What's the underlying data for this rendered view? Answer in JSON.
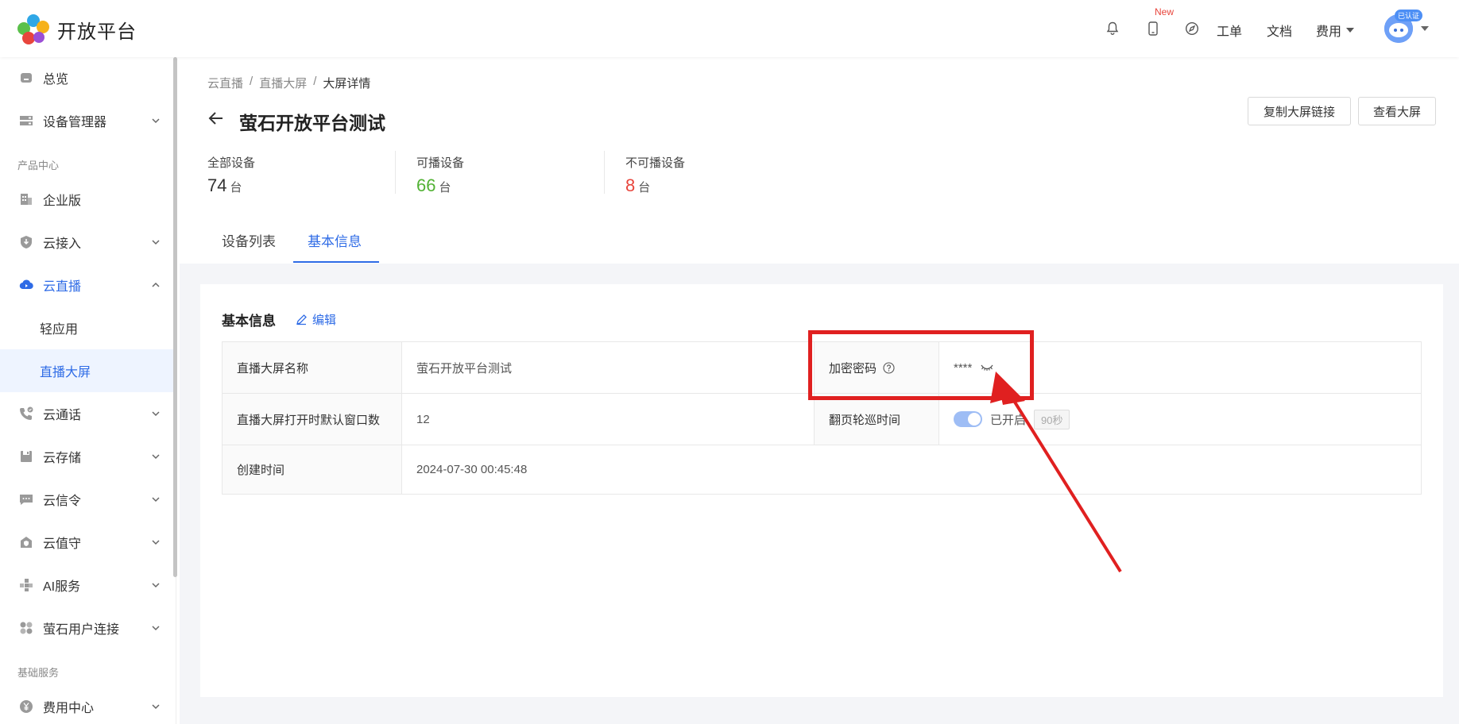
{
  "header": {
    "logo_text": "开放平台",
    "new_badge": "New",
    "links": [
      "工单",
      "文档"
    ],
    "fee_label": "费用",
    "verified_label": "已认证"
  },
  "sidebar": {
    "items": [
      {
        "label": "总览",
        "icon": "home-icon"
      },
      {
        "label": "设备管理器",
        "icon": "device-manager-icon"
      },
      {
        "label": "企业版",
        "icon": "building-icon"
      },
      {
        "label": "云接入",
        "icon": "cloud-access-icon"
      },
      {
        "label": "云直播",
        "icon": "cloud-live-icon"
      },
      {
        "label": "云通话",
        "icon": "phone-icon"
      },
      {
        "label": "云存储",
        "icon": "storage-icon"
      },
      {
        "label": "云信令",
        "icon": "message-icon"
      },
      {
        "label": "云值守",
        "icon": "guard-icon"
      },
      {
        "label": "AI服务",
        "icon": "ai-icon"
      },
      {
        "label": "萤石用户连接",
        "icon": "user-connect-icon"
      },
      {
        "label": "费用中心",
        "icon": "yen-icon"
      }
    ],
    "subitems": [
      "轻应用",
      "直播大屏"
    ],
    "groups": [
      "产品中心",
      "基础服务"
    ]
  },
  "breadcrumb": [
    "云直播",
    "直播大屏",
    "大屏详情"
  ],
  "breadcrumb_sep": "/",
  "page_title": "萤石开放平台测试",
  "buttons": {
    "copy_link": "复制大屏链接",
    "view_screen": "查看大屏"
  },
  "stats": [
    {
      "label": "全部设备",
      "value": "74",
      "unit": "台",
      "color": "#333333"
    },
    {
      "label": "可播设备",
      "value": "66",
      "unit": "台",
      "color": "#52b234"
    },
    {
      "label": "不可播设备",
      "value": "8",
      "unit": "台",
      "color": "#e8453c"
    }
  ],
  "tabs": [
    "设备列表",
    "基本信息"
  ],
  "basic_info": {
    "title": "基本信息",
    "edit_label": "编辑",
    "rows": {
      "name_label": "直播大屏名称",
      "name_value": "萤石开放平台测试",
      "password_label": "加密密码",
      "password_value": "****",
      "window_label": "直播大屏打开时默认窗口数",
      "window_value": "12",
      "rotate_label": "翻页轮巡时间",
      "rotate_status": "已开启",
      "rotate_interval": "90秒",
      "created_label": "创建时间",
      "created_value": "2024-07-30 00:45:48"
    }
  },
  "colors": {
    "accent": "#2e6be6",
    "annotation": "#e02020"
  }
}
